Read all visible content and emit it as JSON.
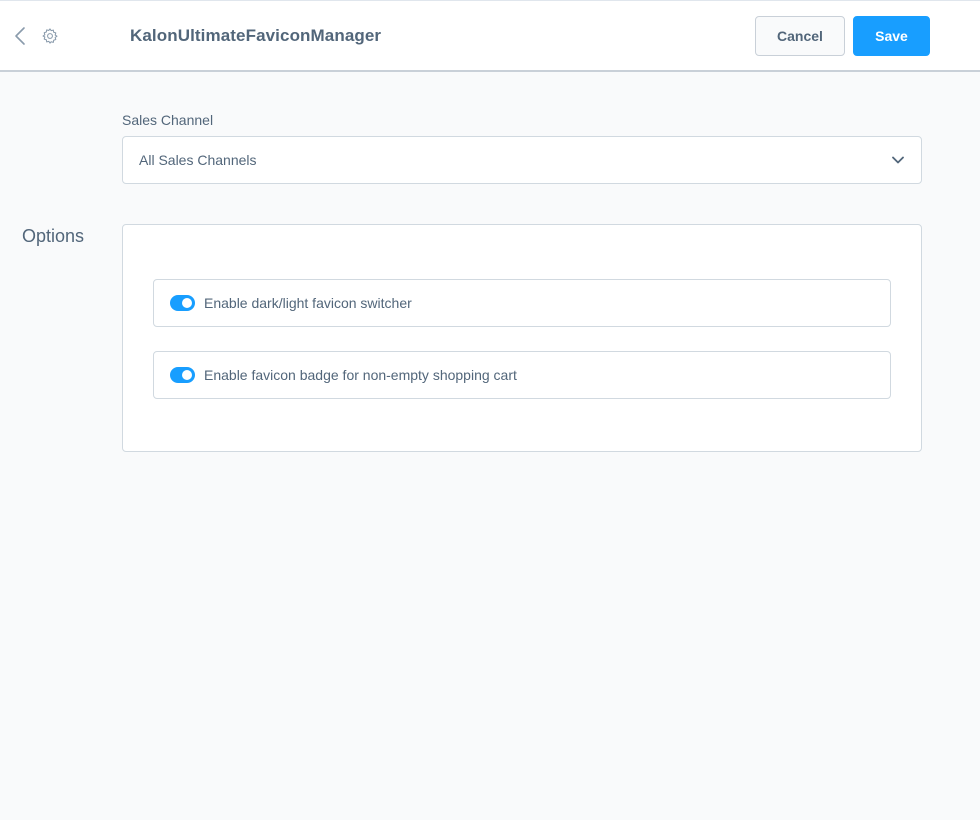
{
  "header": {
    "title": "KalonUltimateFaviconManager",
    "back_icon": "chevron-left-icon",
    "settings_icon": "gear-icon",
    "cancel_label": "Cancel",
    "save_label": "Save"
  },
  "sales_channel": {
    "label": "Sales Channel",
    "selected": "All Sales Channels",
    "dropdown_icon": "chevron-down-icon"
  },
  "options": {
    "title": "Options",
    "items": [
      {
        "label": "Enable dark/light favicon switcher",
        "enabled": true
      },
      {
        "label": "Enable favicon badge for non-empty shopping cart",
        "enabled": true
      }
    ]
  },
  "colors": {
    "accent": "#189eff",
    "text": "#52667a",
    "background": "#f9fafb",
    "border": "#d1d9e0"
  }
}
